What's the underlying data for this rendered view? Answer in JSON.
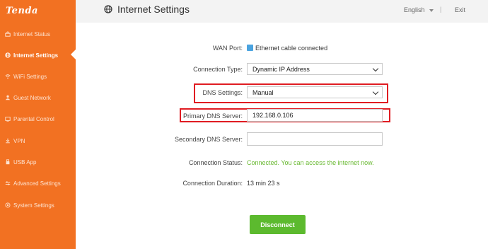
{
  "brand": {
    "logo": "Tenda",
    "accent": "#f27122"
  },
  "sidebar": {
    "items": [
      {
        "label": "Internet Status",
        "icon": "internet-status-icon"
      },
      {
        "label": "Internet Settings",
        "icon": "globe-icon",
        "active": true
      },
      {
        "label": "WiFi Settings",
        "icon": "wifi-icon"
      },
      {
        "label": "Guest Network",
        "icon": "guest-network-icon"
      },
      {
        "label": "Parental Control",
        "icon": "parental-control-icon"
      },
      {
        "label": "VPN",
        "icon": "vpn-icon"
      },
      {
        "label": "USB App",
        "icon": "usb-icon"
      },
      {
        "label": "Advanced Settings",
        "icon": "advanced-settings-icon"
      },
      {
        "label": "System Settings",
        "icon": "gear-icon"
      }
    ]
  },
  "header": {
    "title": "Internet Settings",
    "language": "English",
    "separator": "|",
    "exit": "Exit"
  },
  "form": {
    "wan_port": {
      "label": "WAN Port:",
      "value": "Ethernet cable connected"
    },
    "connection_type": {
      "label": "Connection Type:",
      "value": "Dynamic IP Address"
    },
    "dns_settings": {
      "label": "DNS Settings:",
      "value": "Manual"
    },
    "primary_dns": {
      "label": "Primary DNS Server:",
      "value": "192.168.0.106"
    },
    "secondary_dns": {
      "label": "Secondary DNS Server:",
      "value": ""
    },
    "connection_status": {
      "label": "Connection Status:",
      "value": "Connected. You can access the internet now."
    },
    "connection_duration": {
      "label": "Connection Duration:",
      "value": "13 min 23 s"
    }
  },
  "actions": {
    "disconnect": "Disconnect"
  },
  "colors": {
    "status_ok": "#67b82f",
    "highlight": "#e01c22",
    "button": "#5cba2e"
  }
}
